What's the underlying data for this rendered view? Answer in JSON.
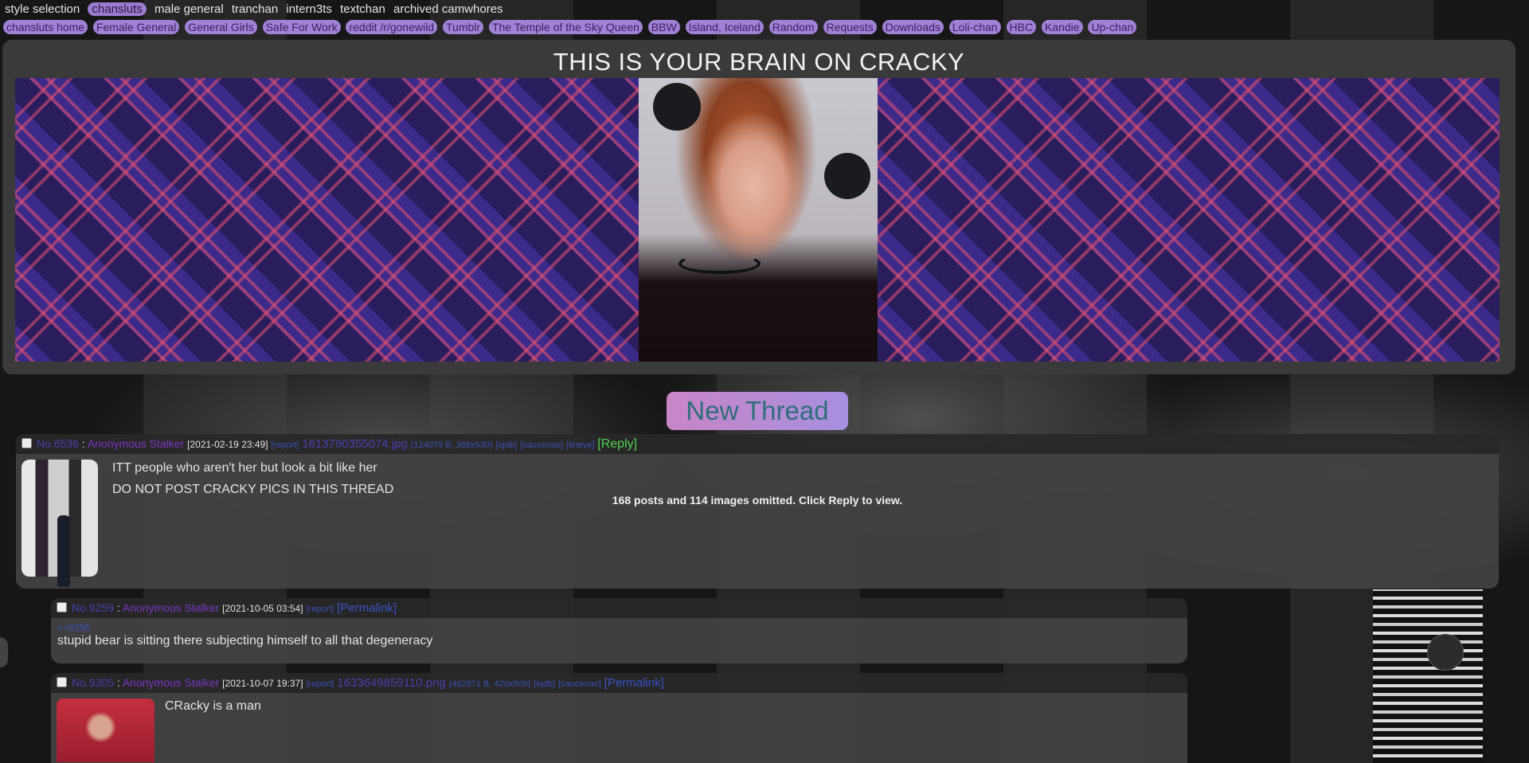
{
  "top_nav": [
    "style selection",
    "chansluts",
    "male general",
    "tranchan",
    "intern3ts",
    "textchan",
    "archived camwhores"
  ],
  "board_links": [
    "chansluts home",
    "Female General",
    "General Girls",
    "Safe For Work",
    "reddit /r/gonewild",
    "Tumblr",
    "The Temple of the Sky Queen",
    "BBW",
    "Island, Iceland",
    "Random",
    "Requests",
    "Downloads",
    "Loli-chan",
    "HBC",
    "Kandie",
    "Up-chan"
  ],
  "site_title": "THIS IS YOUR BRAIN ON CRACKY",
  "new_thread_label": "New Thread",
  "thread": {
    "no": "No.6536",
    "name": "Anonymous Stalker",
    "date": "[2021-02-19 23:49]",
    "report": "[report]",
    "file": "1613790355074.jpg",
    "file_info": "(124079 B, 368x530)",
    "links": [
      "[iqdb]",
      "[saucenao]",
      "[tineye]"
    ],
    "reply": "[Reply]",
    "lines": [
      "ITT people who aren't her but look a bit like her",
      "DO NOT POST CRACKY PICS IN THIS THREAD"
    ],
    "omitted": "168 posts and 114 images omitted. Click Reply to view."
  },
  "reply1": {
    "no": "No.9259",
    "name": "Anonymous Stalker",
    "date": "[2021-10-05 03:54]",
    "report": "[report]",
    "permalink": "[Permalink]",
    "quote": ">>9256",
    "text": "stupid bear is sitting there subjecting himself to all that degeneracy"
  },
  "reply2": {
    "no": "No.9305",
    "name": "Anonymous Stalker",
    "date": "[2021-10-07 19:37]",
    "report": "[report]",
    "file": "1633649859110.png",
    "file_info": "(482871 B, 420x509)",
    "links": [
      "[iqdb]",
      "[saucenao]"
    ],
    "permalink": "[Permalink]",
    "text": "CRacky is a man"
  }
}
